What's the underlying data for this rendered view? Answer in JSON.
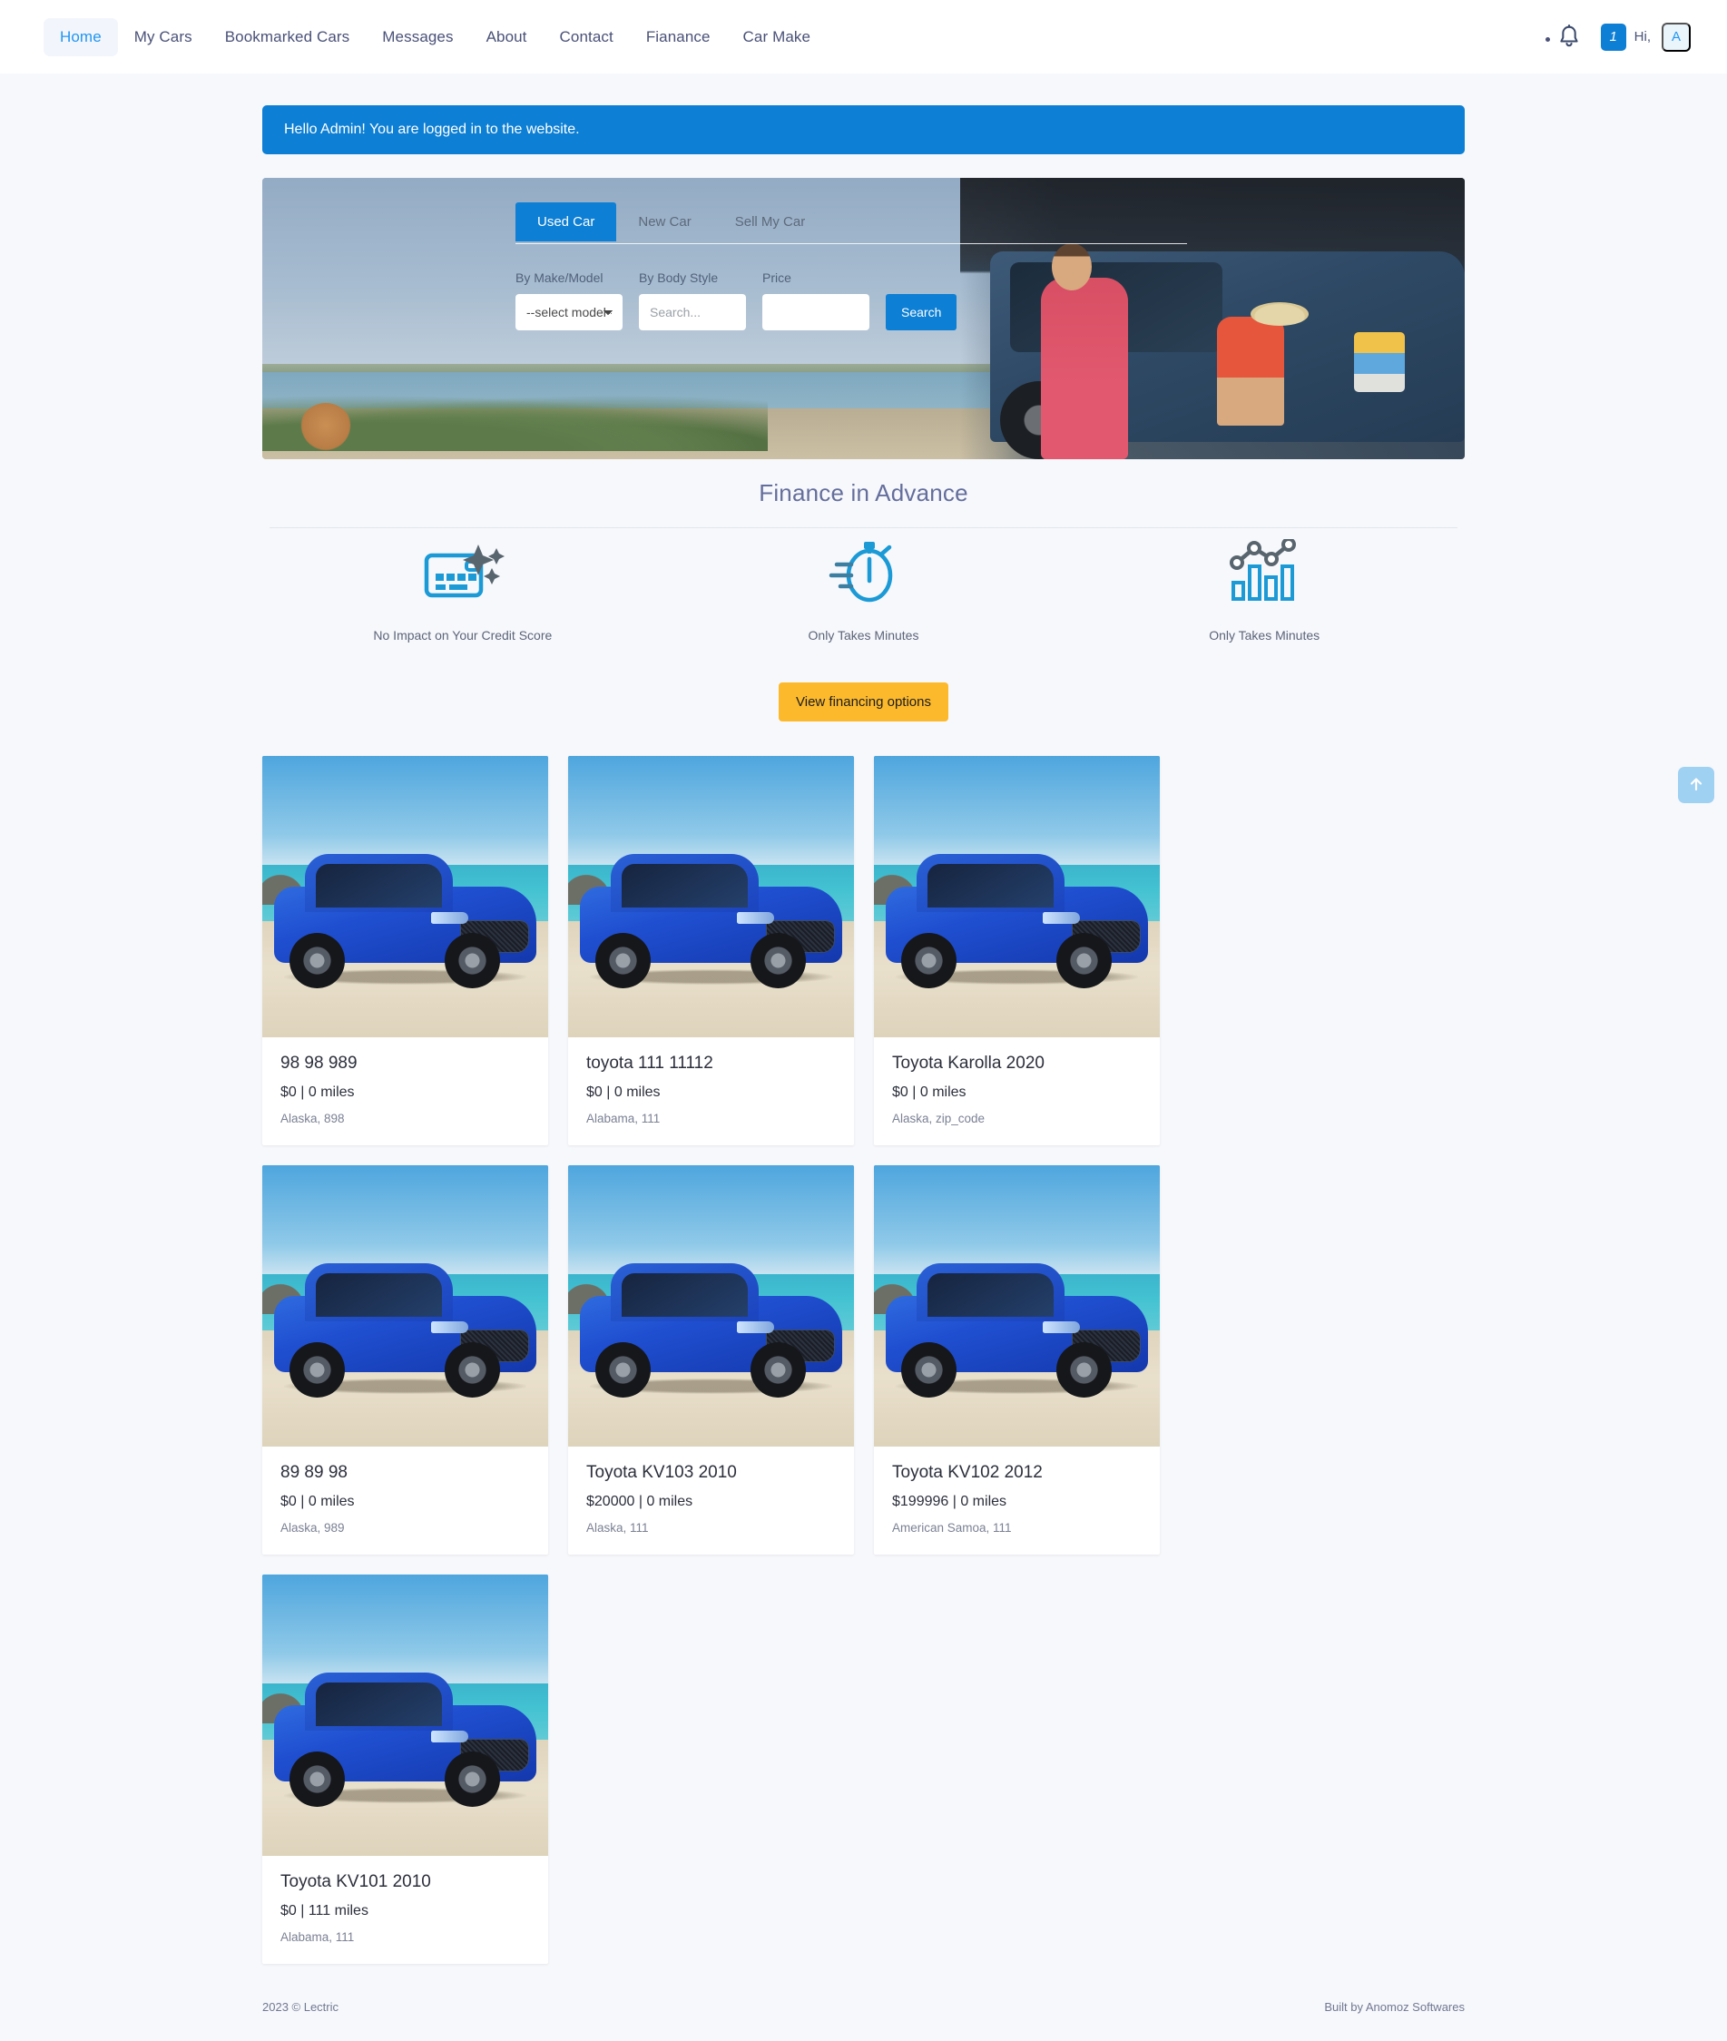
{
  "navbar": {
    "links": [
      {
        "label": "Home",
        "active": true
      },
      {
        "label": "My Cars",
        "active": false
      },
      {
        "label": "Bookmarked Cars",
        "active": false
      },
      {
        "label": "Messages",
        "active": false
      },
      {
        "label": "About",
        "active": false
      },
      {
        "label": "Contact",
        "active": false
      },
      {
        "label": "Fianance",
        "active": false
      },
      {
        "label": "Car Make",
        "active": false
      }
    ],
    "message_count": "1",
    "greeting": "Hi,",
    "avatar_initial": "A",
    "bell_icon": "bell-icon",
    "notification_dot": true
  },
  "alert": {
    "message": "Hello Admin! You are logged in to the website."
  },
  "hero": {
    "tabs": [
      {
        "label": "Used Car",
        "active": true
      },
      {
        "label": "New Car",
        "active": false
      },
      {
        "label": "Sell My Car",
        "active": false
      }
    ],
    "fields": {
      "make_label": "By Make/Model",
      "make_value": "--select model--",
      "body_label": "By Body Style",
      "body_placeholder": "Search...",
      "body_value": "",
      "price_label": "Price",
      "price_placeholder": "",
      "price_value": ""
    },
    "search_button": "Search"
  },
  "finance": {
    "title": "Finance in Advance",
    "features": [
      {
        "icon": "credit-card-sparkle-icon",
        "caption": "No Impact on Your Credit Score"
      },
      {
        "icon": "stopwatch-icon",
        "caption": "Only Takes Minutes"
      },
      {
        "icon": "bar-chart-line-icon",
        "caption": "Only Takes Minutes"
      }
    ],
    "cta_label": "View financing options"
  },
  "listings": [
    {
      "title": "98 98 989",
      "price_miles": "$0 | 0 miles",
      "location": "Alaska, 898"
    },
    {
      "title": "toyota 111 11112",
      "price_miles": "$0 | 0 miles",
      "location": "Alabama, 111"
    },
    {
      "title": "Toyota Karolla 2020",
      "price_miles": "$0 | 0 miles",
      "location": "Alaska, zip_code"
    },
    {
      "title": "89 89 98",
      "price_miles": "$0 | 0 miles",
      "location": "Alaska, 989"
    },
    {
      "title": "Toyota KV103 2010",
      "price_miles": "$20000 | 0 miles",
      "location": "Alaska, 111"
    },
    {
      "title": "Toyota KV102 2012",
      "price_miles": "$199996 | 0 miles",
      "location": "American Samoa, 111"
    },
    {
      "title": "Toyota KV101 2010",
      "price_miles": "$0 | 111 miles",
      "location": "Alabama, 111"
    }
  ],
  "footer": {
    "left": "2023  © Lectric",
    "right": "Built by Anomoz Softwares"
  },
  "scroll_top": {
    "icon": "arrow-up-icon"
  },
  "colors": {
    "primary_blue": "#0d7fd4",
    "accent_link": "#2196f3",
    "cta_yellow": "#fcb92c",
    "heading_slate": "#646e9c",
    "page_bg": "#f7f8fc",
    "icon_blue": "#1b9ad6",
    "icon_slate": "#58656e"
  }
}
